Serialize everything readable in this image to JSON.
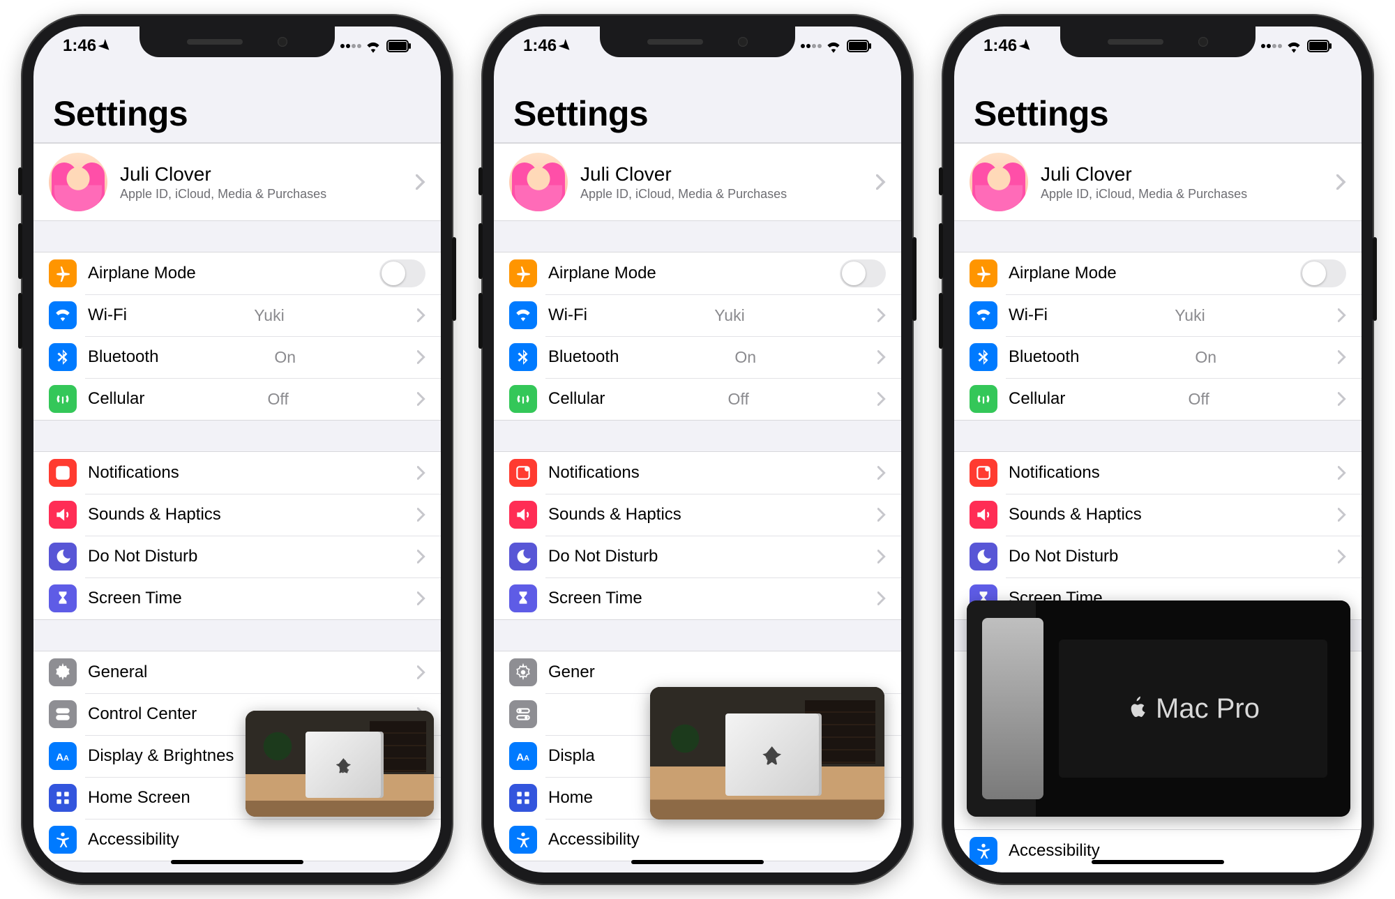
{
  "status": {
    "time": "1:46"
  },
  "title": "Settings",
  "account": {
    "name": "Juli Clover",
    "subtitle": "Apple ID, iCloud, Media & Purchases"
  },
  "rows": {
    "airplane": "Airplane Mode",
    "wifi": "Wi-Fi",
    "wifi_value": "Yuki",
    "bluetooth": "Bluetooth",
    "bluetooth_value": "On",
    "cellular": "Cellular",
    "cellular_value": "Off",
    "notifications": "Notifications",
    "sounds": "Sounds & Haptics",
    "dnd": "Do Not Disturb",
    "screentime": "Screen Time",
    "general": "General",
    "controlcenter": "Control Center",
    "display": "Display & Brightness",
    "display_trunc": "Display & Brightnes",
    "display_trunc2": "Displa",
    "homescreen": "Home Screen",
    "homescreen_trunc": "Home",
    "accessibility": "Accessibility",
    "general_trunc": "Gener"
  },
  "pip": {
    "label": "Mac Pro"
  }
}
